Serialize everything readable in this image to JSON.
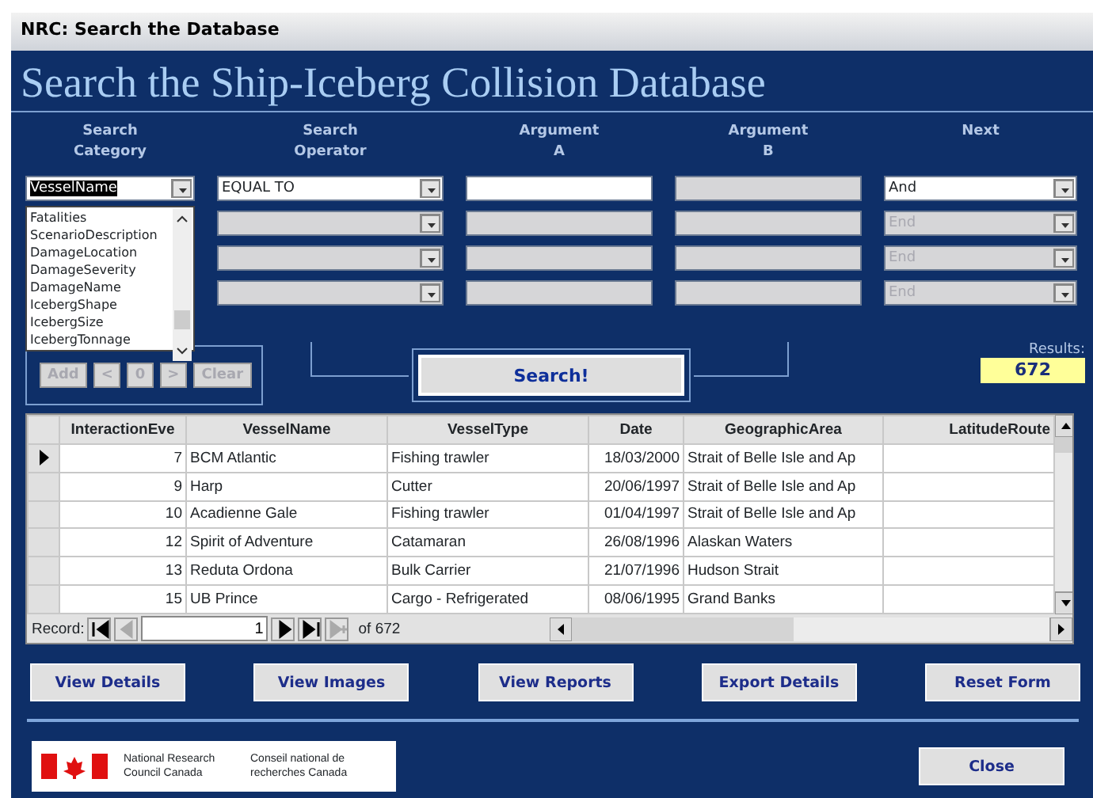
{
  "window": {
    "title": "NRC: Search the Database"
  },
  "heading": "Search the Ship-Iceberg Collision Database",
  "column_headers": [
    {
      "lines": [
        "Search",
        "Category"
      ]
    },
    {
      "lines": [
        "Search",
        "Operator"
      ]
    },
    {
      "lines": [
        "Argument",
        "A"
      ]
    },
    {
      "lines": [
        "Argument",
        "B"
      ]
    },
    {
      "lines": [
        "Next"
      ]
    }
  ],
  "category_field": {
    "value": "VesselName"
  },
  "category_list": {
    "items": [
      "Fatalities",
      "ScenarioDescription",
      "DamageLocation",
      "DamageSeverity",
      "DamageName",
      "IcebergShape",
      "IcebergSize",
      "IcebergTonnage"
    ]
  },
  "criteria": [
    {
      "operator": {
        "value": "EQUAL TO",
        "disabled": false
      },
      "argument_a": {
        "disabled": false
      },
      "argument_b": {
        "disabled": true
      },
      "next": {
        "value": "And",
        "disabled": false
      }
    },
    {
      "operator": {
        "disabled": true
      },
      "argument_a": {
        "disabled": true
      },
      "argument_b": {
        "disabled": true
      },
      "next": {
        "value": "End",
        "disabled": true
      }
    },
    {
      "operator": {
        "disabled": true
      },
      "argument_a": {
        "disabled": true
      },
      "argument_b": {
        "disabled": true
      },
      "next": {
        "value": "End",
        "disabled": true
      }
    },
    {
      "operator": {
        "disabled": true
      },
      "argument_a": {
        "disabled": true
      },
      "argument_b": {
        "disabled": true
      },
      "next": {
        "value": "End",
        "disabled": true
      }
    }
  ],
  "edit_buttons": [
    {
      "label": "Add",
      "disabled": true
    },
    {
      "label": "<",
      "disabled": true
    },
    {
      "label": "0",
      "disabled": true
    },
    {
      "label": ">",
      "disabled": true
    },
    {
      "label": "Clear",
      "disabled": true
    }
  ],
  "search_button": "Search!",
  "results": {
    "label": "Results:",
    "value": "672"
  },
  "table": {
    "columns": [
      "InteractionEve",
      "VesselName",
      "VesselType",
      "Date",
      "GeographicArea",
      "LatitudeRoute"
    ],
    "rows": [
      {
        "selected": true,
        "cells": [
          "7",
          "BCM Atlantic",
          "Fishing trawler",
          "18/03/2000",
          "Strait of Belle Isle and Ap"
        ]
      },
      {
        "selected": false,
        "cells": [
          "9",
          "Harp",
          "Cutter",
          "20/06/1997",
          "Strait of Belle Isle and Ap"
        ]
      },
      {
        "selected": false,
        "cells": [
          "10",
          "Acadienne Gale",
          "Fishing trawler",
          "01/04/1997",
          "Strait of Belle Isle and Ap"
        ]
      },
      {
        "selected": false,
        "cells": [
          "12",
          "Spirit of Adventure",
          "Catamaran",
          "26/08/1996",
          "Alaskan Waters"
        ]
      },
      {
        "selected": false,
        "cells": [
          "13",
          "Reduta Ordona",
          "Bulk Carrier",
          "21/07/1996",
          "Hudson Strait"
        ]
      },
      {
        "selected": false,
        "cells": [
          "15",
          "UB Prince",
          "Cargo - Refrigerated",
          "08/06/1995",
          "Grand Banks"
        ]
      }
    ]
  },
  "navigator": {
    "label": "Record:",
    "current": "1",
    "total": "of 672",
    "buttons": [
      {
        "kind": "first",
        "disabled": false
      },
      {
        "kind": "prev",
        "disabled": true
      },
      {
        "kind": "next",
        "disabled": false
      },
      {
        "kind": "last",
        "disabled": false
      },
      {
        "kind": "new",
        "disabled": true
      }
    ]
  },
  "action_buttons": [
    "View Details",
    "View Images",
    "View Reports",
    "Export Details",
    "Reset Form"
  ],
  "logo": {
    "english": "National Research Council Canada",
    "french": "Conseil national de recherches Canada"
  },
  "close_button": "Close"
}
